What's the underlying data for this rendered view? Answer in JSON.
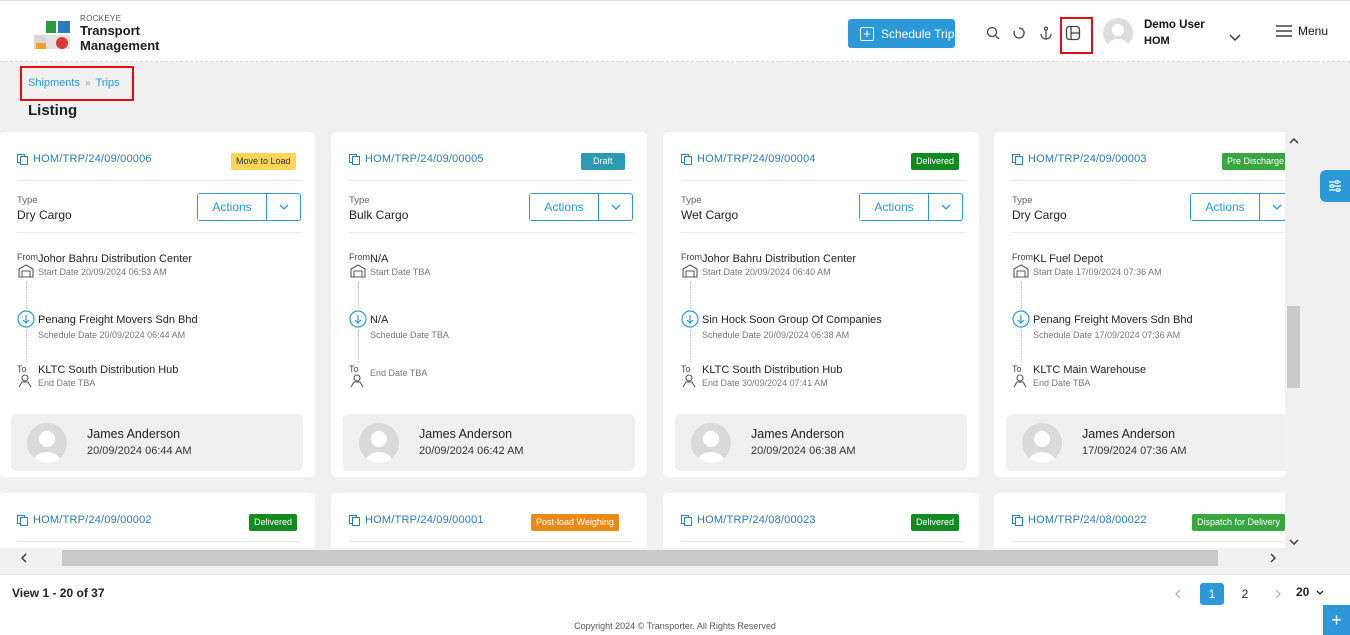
{
  "header": {
    "brand_small": "ROCKEYE",
    "brand_line1": "Transport",
    "brand_line2": "Management",
    "schedule_label": "Schedule Trip",
    "user_name": "Demo User",
    "user_org": "HOM",
    "menu_label": "Menu"
  },
  "breadcrumb": {
    "shipments": "Shipments",
    "separator": "»",
    "trips": "Trips"
  },
  "page_title": "Listing",
  "cards": [
    {
      "id": "HOM/TRP/24/09/00006",
      "status": "Move to Load",
      "status_color": "#fbd558",
      "type_label": "Type",
      "type": "Dry Cargo",
      "actions_label": "Actions",
      "from_label": "From",
      "from": "Johor Bahru Distribution Center",
      "start_date": "Start Date 20/09/2024 06:53 AM",
      "via": "Penang Freight Movers Sdn Bhd",
      "schedule_date": "Schedule Date 20/09/2024 06:44 AM",
      "to_label": "To",
      "to": "KLTC South Distribution Hub",
      "end_date": "End Date TBA",
      "driver": "James Anderson",
      "driver_time": "20/09/2024 06:44 AM"
    },
    {
      "id": "HOM/TRP/24/09/00005",
      "status": "Draft",
      "status_color": "#2a9bb0",
      "type_label": "Type",
      "type": "Bulk Cargo",
      "actions_label": "Actions",
      "from_label": "From",
      "from": "N/A",
      "start_date": "Start Date TBA",
      "via": "N/A",
      "schedule_date": "Schedule Date TBA",
      "to_label": "To",
      "to": "",
      "end_date": "End Date TBA",
      "driver": "James Anderson",
      "driver_time": "20/09/2024 06:42 AM"
    },
    {
      "id": "HOM/TRP/24/09/00004",
      "status": "Delivered",
      "status_color": "#138a20",
      "type_label": "Type",
      "type": "Wet Cargo",
      "actions_label": "Actions",
      "from_label": "From",
      "from": "Johor Bahru Distribution Center",
      "start_date": "Start Date 20/09/2024 06:40 AM",
      "via": "Sin Hock Soon Group Of Companies",
      "schedule_date": "Schedule Date 20/09/2024 06:38 AM",
      "to_label": "To",
      "to": "KLTC South Distribution Hub",
      "end_date": "End Date 30/09/2024 07:41 AM",
      "driver": "James Anderson",
      "driver_time": "20/09/2024 06:38 AM"
    },
    {
      "id": "HOM/TRP/24/09/00003",
      "status": "Pre Discharge",
      "status_color": "#3aa642",
      "type_label": "Type",
      "type": "Dry Cargo",
      "actions_label": "Actions",
      "from_label": "From",
      "from": "KL Fuel Depot",
      "start_date": "Start Date 17/09/2024 07:36 AM",
      "via": "Penang Freight Movers Sdn Bhd",
      "schedule_date": "Schedule Date 17/09/2024 07:36 AM",
      "to_label": "To",
      "to": "KLTC Main Warehouse",
      "end_date": "End Date TBA",
      "driver": "James Anderson",
      "driver_time": "17/09/2024 07:36 AM"
    },
    {
      "id": "HOM/TRP/24/09/00002",
      "status": "Delivered",
      "status_color": "#138a20"
    },
    {
      "id": "HOM/TRP/24/09/00001",
      "status": "Post-load Weighing",
      "status_color": "#e98a16"
    },
    {
      "id": "HOM/TRP/24/08/00023",
      "status": "Delivered",
      "status_color": "#138a20"
    },
    {
      "id": "HOM/TRP/24/08/00022",
      "status": "Dispatch for Delivery",
      "status_color": "#3aa642"
    }
  ],
  "pagination": {
    "view_text": "View 1 - 20 of 37",
    "pages": [
      "1",
      "2"
    ],
    "current_page": "1",
    "per_page": "20"
  },
  "footer": {
    "copyright": "Copyright 2024 © Transporter. All Rights Reserved"
  }
}
